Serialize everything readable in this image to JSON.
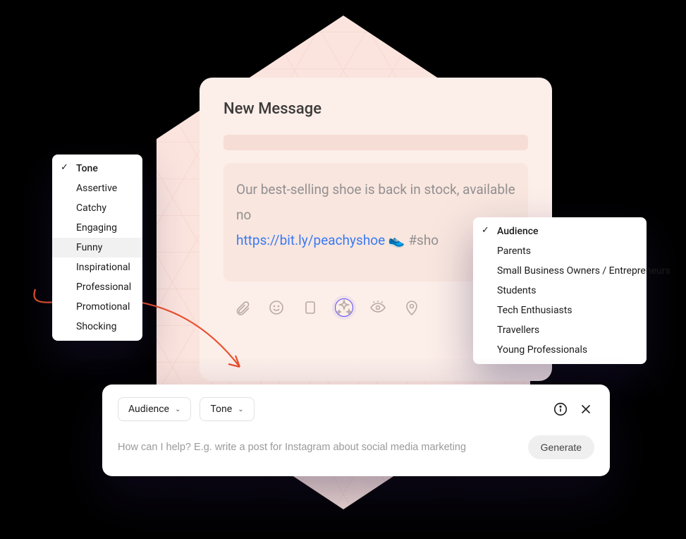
{
  "message": {
    "title": "New Message",
    "body_prefix": "Our best-selling shoe is back in stock, available no",
    "link": "https://bit.ly/peachyshoe",
    "emoji": "👟",
    "hashtag": "#sho"
  },
  "toolbar_icons": [
    "attachment-icon",
    "emoji-icon",
    "media-icon",
    "ai-sparkle-icon",
    "preview-icon",
    "location-icon"
  ],
  "tone_menu": {
    "header": "Tone",
    "items": [
      "Assertive",
      "Catchy",
      "Engaging",
      "Funny",
      "Inspirational",
      "Professional",
      "Promotional",
      "Shocking"
    ],
    "hovered": "Funny"
  },
  "audience_menu": {
    "header": "Audience",
    "items": [
      "Parents",
      "Small Business Owners / Entrepreneurs",
      "Students",
      "Tech Enthusiasts",
      "Travellers",
      "Young Professionals"
    ]
  },
  "ai_bar": {
    "audience_label": "Audience",
    "tone_label": "Tone",
    "placeholder": "How can I help? E.g. write a post for Instagram about social media marketing",
    "generate_label": "Generate"
  },
  "colors": {
    "bg_peach": "#fbe4de",
    "card_peach": "#fceee9",
    "accent_blue": "#5a4df0",
    "link_blue": "#3a7af0",
    "arrow_red": "#e9502f"
  }
}
